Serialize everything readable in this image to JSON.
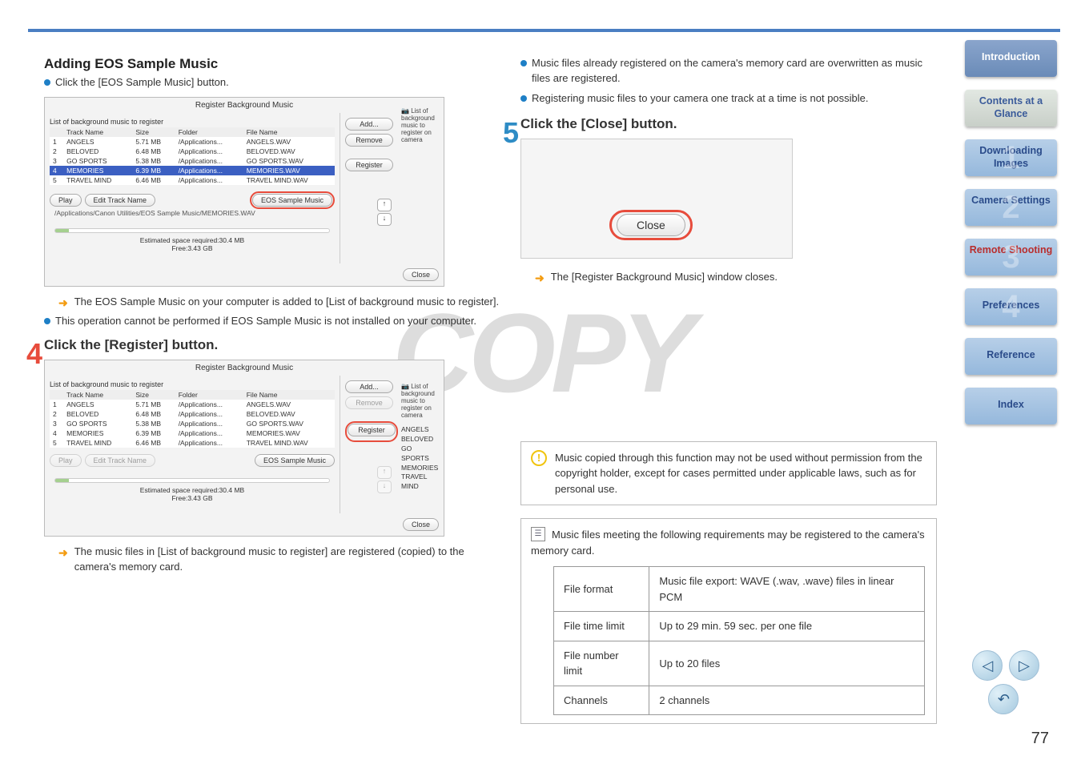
{
  "step3": {
    "heading": "Adding EOS Sample Music",
    "instruction": "Click the [EOS Sample Music] button.",
    "result": "The EOS Sample Music on your computer is added to [List of background music to register].",
    "note": "This operation cannot be performed if EOS Sample Music is not installed on your computer."
  },
  "step4": {
    "num": "4",
    "heading": "Click the [Register] button.",
    "result": "The music files in [List of background music to register] are registered (copied) to the camera's memory card."
  },
  "step5": {
    "num": "5",
    "heading": "Click the [Close] button.",
    "close_label": "Close",
    "result": "The [Register Background Music] window closes."
  },
  "right_notes": {
    "n1": "Music files already registered on the camera's memory card are overwritten as music files are registered.",
    "n2": "Registering music files to your camera one track at a time is not possible."
  },
  "caution": "Music copied through this function may not be used without permission from the copyright holder, except for cases permitted under applicable laws, such as for personal use.",
  "info_lead": "Music files meeting the following requirements may be registered to the camera's memory card.",
  "reqs": {
    "r1k": "File format",
    "r1v": "Music file export: WAVE (.wav, .wave) files in linear PCM",
    "r2k": "File time limit",
    "r2v": "Up to 29 min. 59 sec. per one file",
    "r3k": "File number limit",
    "r3v": "Up to 20 files",
    "r4k": "Channels",
    "r4v": "2 channels"
  },
  "dialog": {
    "title": "Register Background Music",
    "list_label": "List of background music to register",
    "camera_label": "List of background music to register on camera",
    "cols": {
      "c1": "Track Name",
      "c2": "Size",
      "c3": "Folder",
      "c4": "File Name"
    },
    "tracks": [
      {
        "i": "1",
        "name": "ANGELS",
        "size": "5.71 MB",
        "folder": "/Applications...",
        "file": "ANGELS.WAV"
      },
      {
        "i": "2",
        "name": "BELOVED",
        "size": "6.48 MB",
        "folder": "/Applications...",
        "file": "BELOVED.WAV"
      },
      {
        "i": "3",
        "name": "GO SPORTS",
        "size": "5.38 MB",
        "folder": "/Applications...",
        "file": "GO SPORTS.WAV"
      },
      {
        "i": "4",
        "name": "MEMORIES",
        "size": "6.39 MB",
        "folder": "/Applications...",
        "file": "MEMORIES.WAV"
      },
      {
        "i": "5",
        "name": "TRAVEL MIND",
        "size": "6.46 MB",
        "folder": "/Applications...",
        "file": "TRAVEL MIND.WAV"
      }
    ],
    "add": "Add...",
    "remove": "Remove",
    "register": "Register",
    "play": "Play",
    "edit": "Edit Track Name",
    "eos": "EOS Sample Music",
    "path": "/Applications/Canon Utilities/EOS Sample Music/MEMORIES.WAV",
    "space": "Estimated space required:30.4 MB",
    "free": "Free:3.43 GB",
    "close": "Close",
    "cam_tracks": [
      "ANGELS",
      "BELOVED",
      "GO SPORTS",
      "MEMORIES",
      "TRAVEL MIND"
    ]
  },
  "sidebar": {
    "intro": "Introduction",
    "contents": "Contents at a Glance",
    "b1": "Downloading Images",
    "n1": "1",
    "b2": "Camera Settings",
    "n2": "2",
    "b3": "Remote Shooting",
    "n3": "3",
    "b4": "Preferences",
    "n4": "4",
    "b5": "Reference",
    "b6": "Index"
  },
  "watermark": "COPY",
  "page": "77"
}
